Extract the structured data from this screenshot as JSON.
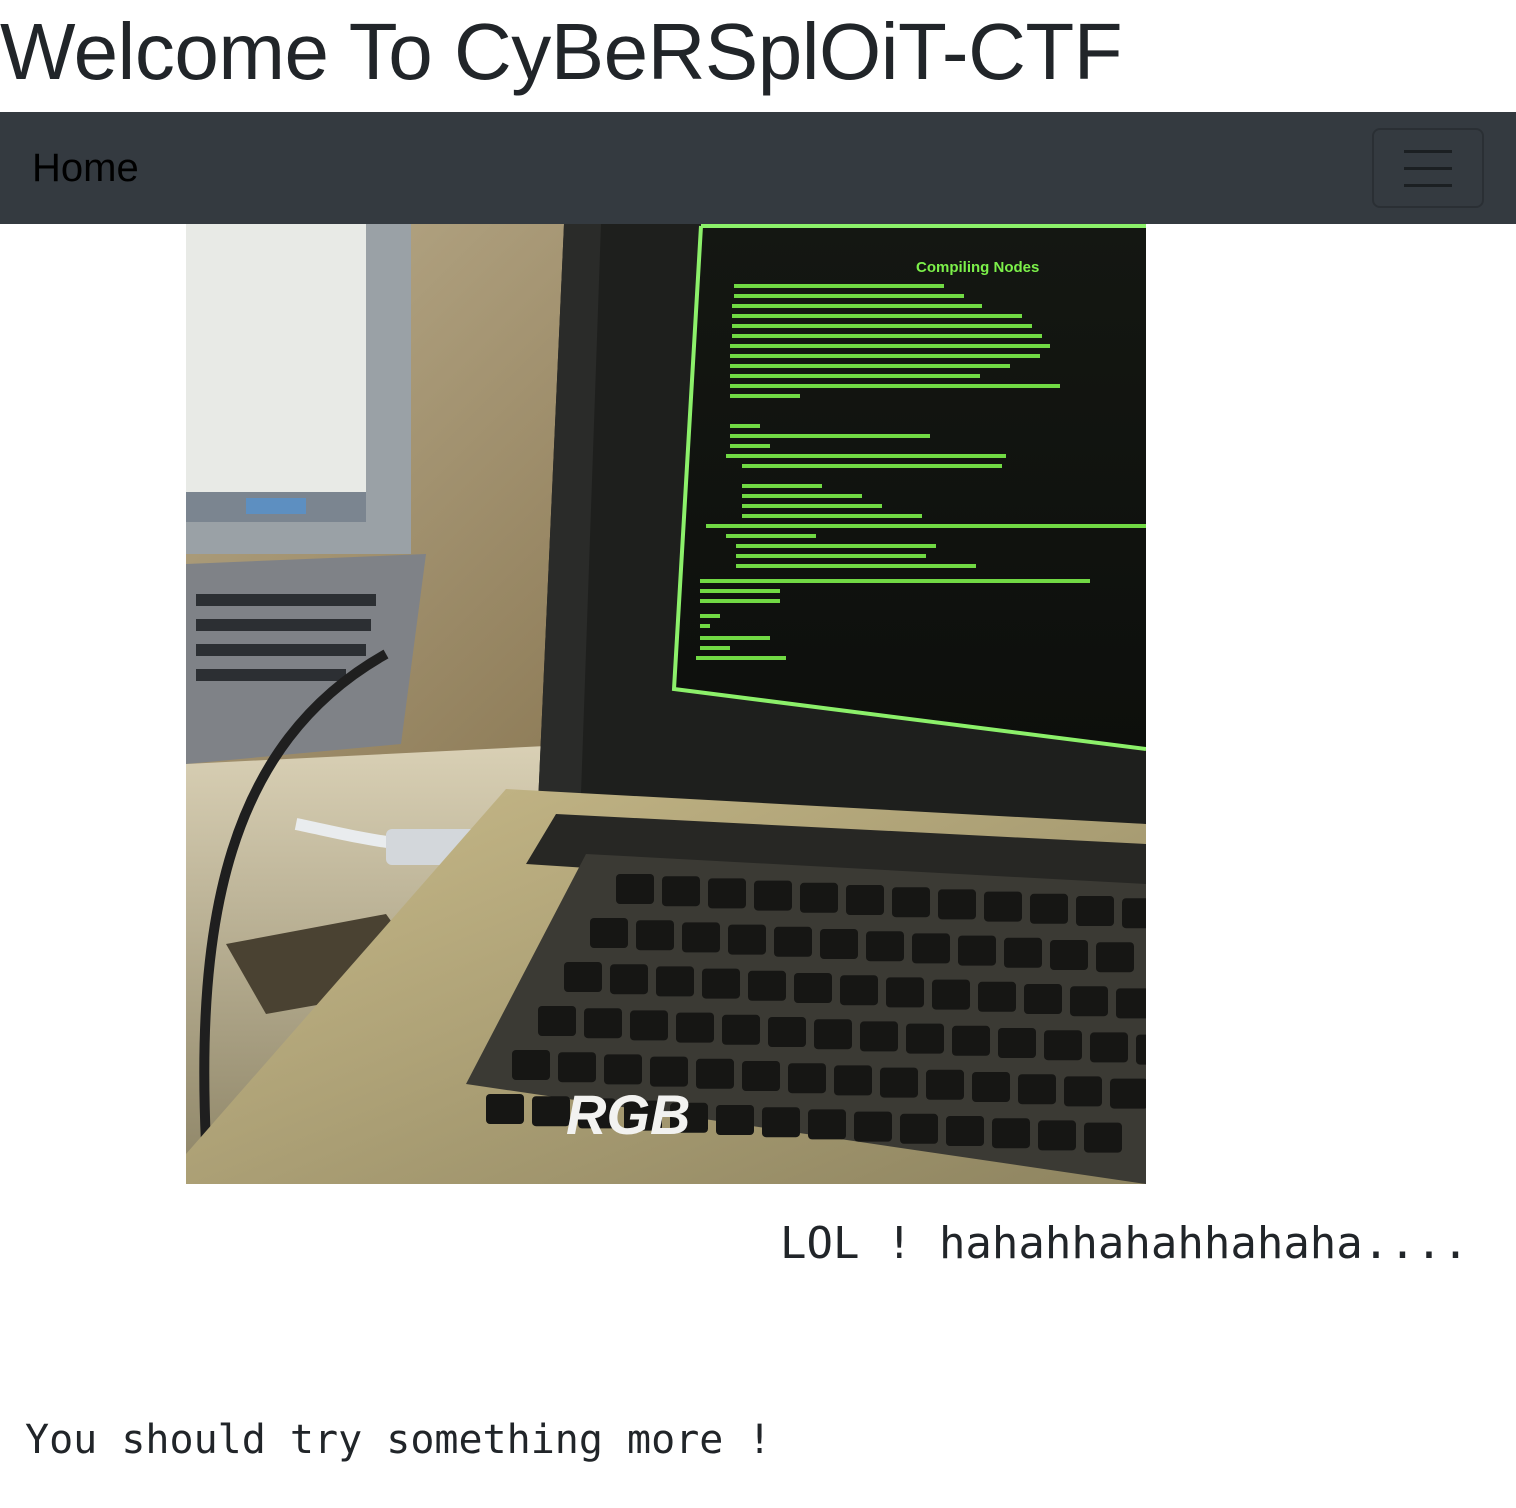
{
  "page": {
    "title": "Welcome To CyBeRSplOiT-CTF"
  },
  "navbar": {
    "home_label": "Home",
    "toggler_icon": "hamburger-icon",
    "background": "#343a40"
  },
  "hero_image": {
    "screen_heading": "Compiling Nodes",
    "watermark": "RGB",
    "code_color": "#7cf04a"
  },
  "marquee_text": "LOL ! hahahhahahhahaha....",
  "hint_text": "You should try something more !"
}
